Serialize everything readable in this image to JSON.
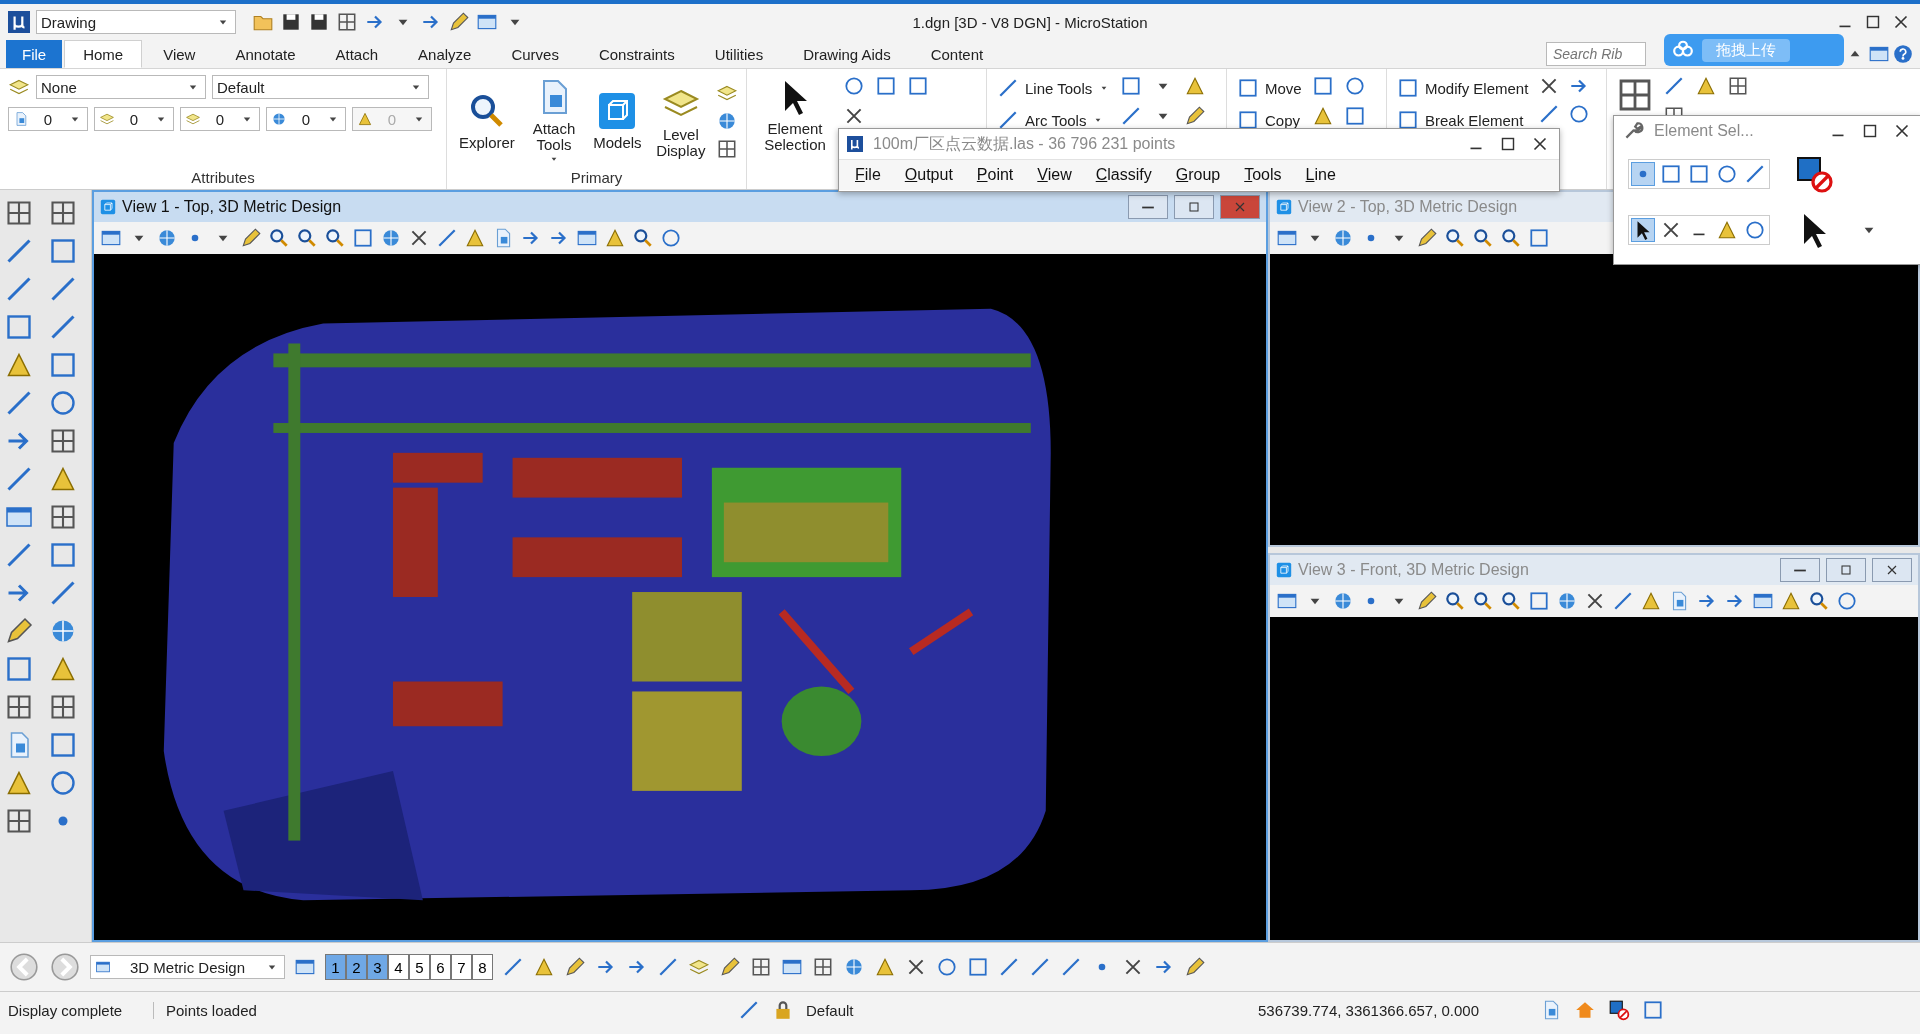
{
  "title_bar": {
    "workflow": "Drawing",
    "title": "1.dgn [3D - V8 DGN] - MicroStation"
  },
  "file_tab": "File",
  "tabs": [
    {
      "label": "Home",
      "selected": true
    },
    {
      "label": "View",
      "selected": false
    },
    {
      "label": "Annotate",
      "selected": false
    },
    {
      "label": "Attach",
      "selected": false
    },
    {
      "label": "Analyze",
      "selected": false
    },
    {
      "label": "Curves",
      "selected": false
    },
    {
      "label": "Constraints",
      "selected": false
    },
    {
      "label": "Utilities",
      "selected": false
    },
    {
      "label": "Drawing Aids",
      "selected": false
    },
    {
      "label": "Content",
      "selected": false
    }
  ],
  "search": {
    "placeholder": "Search Rib"
  },
  "upload_badge": "拖拽上传",
  "attributes": {
    "level": "None",
    "style": "Default",
    "fields": [
      {
        "value": "0",
        "disabled": false
      },
      {
        "value": "0",
        "disabled": false
      },
      {
        "value": "0",
        "disabled": false
      },
      {
        "value": "0",
        "disabled": false
      },
      {
        "value": "0",
        "disabled": true
      }
    ],
    "label": "Attributes"
  },
  "primary": {
    "buttons": [
      {
        "label": "Explorer",
        "dropdown": false
      },
      {
        "label": "Attach Tools",
        "dropdown": true
      },
      {
        "label": "Models",
        "dropdown": false
      },
      {
        "label": "Level Display",
        "dropdown": false
      }
    ],
    "label": "Primary"
  },
  "element_selection": "Element Selection",
  "tools": [
    "Line Tools",
    "Arc Tools"
  ],
  "manipulate": [
    "Move",
    "Copy"
  ],
  "modify": [
    "Modify Element",
    "Break Element"
  ],
  "pointcloud_dialog": {
    "title": "100m厂区点云数据.las - 36 796 231 points",
    "menu": [
      "File",
      "Output",
      "Point",
      "View",
      "Classify",
      "Group",
      "Tools",
      "Line"
    ]
  },
  "element_dialog": {
    "title": "Element Sel..."
  },
  "views": [
    {
      "title": "View 1 - Top, 3D Metric Design",
      "active": true,
      "controls": true
    },
    {
      "title": "View 2 - Top, 3D Metric Design",
      "active": false,
      "controls": false
    },
    {
      "title": "View 3 - Front, 3D Metric Design",
      "active": false,
      "controls": true
    }
  ],
  "bottom_toolbar": {
    "model": "3D Metric Design",
    "view_buttons": [
      {
        "label": "1",
        "selected": true
      },
      {
        "label": "2",
        "selected": true
      },
      {
        "label": "3",
        "selected": true
      },
      {
        "label": "4",
        "selected": false
      },
      {
        "label": "5",
        "selected": false
      },
      {
        "label": "6",
        "selected": false
      },
      {
        "label": "7",
        "selected": false
      },
      {
        "label": "8",
        "selected": false
      }
    ]
  },
  "status_bar": {
    "message": "Display complete",
    "prompt": "Points loaded",
    "level": "Default",
    "coordinates": "536739.774, 3361366.657, 0.000"
  }
}
